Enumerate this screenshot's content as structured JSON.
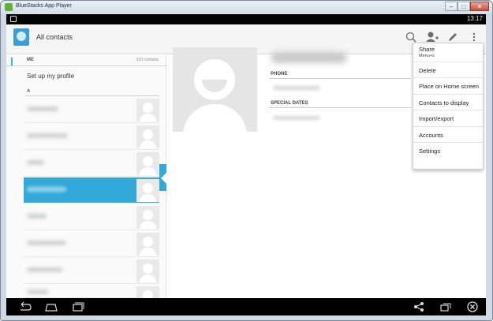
{
  "window": {
    "title": "BlueStacks App Player",
    "controls": {
      "minimize": "–",
      "maximize": "□",
      "close": "✕"
    }
  },
  "statusbar": {
    "time": "13:17"
  },
  "actionbar": {
    "title": "All contacts",
    "icons": [
      "contacts-app-icon",
      "search-icon",
      "add-person-icon",
      "edit-icon",
      "overflow-menu-icon"
    ]
  },
  "list": {
    "me_label": "ME",
    "contact_count": "310 contacts",
    "setup_profile": "Set up my profile",
    "section_letter": "A",
    "contacts": [
      {
        "name": ""
      },
      {
        "name": ""
      },
      {
        "name": ""
      },
      {
        "name": ""
      },
      {
        "name": ""
      },
      {
        "name": ""
      },
      {
        "name": ""
      },
      {
        "name": ""
      }
    ],
    "selected_index": 3
  },
  "detail": {
    "phone_label": "PHONE",
    "special_dates_label": "SPECIAL DATES"
  },
  "menu": {
    "items": [
      {
        "label": "Share",
        "shortcut": "Menu+s"
      },
      {
        "label": "Delete"
      },
      {
        "label": "Place on Home screen"
      },
      {
        "label": "Contacts to display"
      },
      {
        "label": "Import/export"
      },
      {
        "label": "Accounts"
      },
      {
        "label": "Settings"
      }
    ]
  },
  "navbar": {
    "icons": [
      "back-icon",
      "home-icon",
      "recents-icon",
      "share-icon",
      "fullscreen-icon",
      "close-circle-icon"
    ]
  },
  "colors": {
    "accent": "#33b5e5",
    "selected_row": "#33a9d9"
  }
}
